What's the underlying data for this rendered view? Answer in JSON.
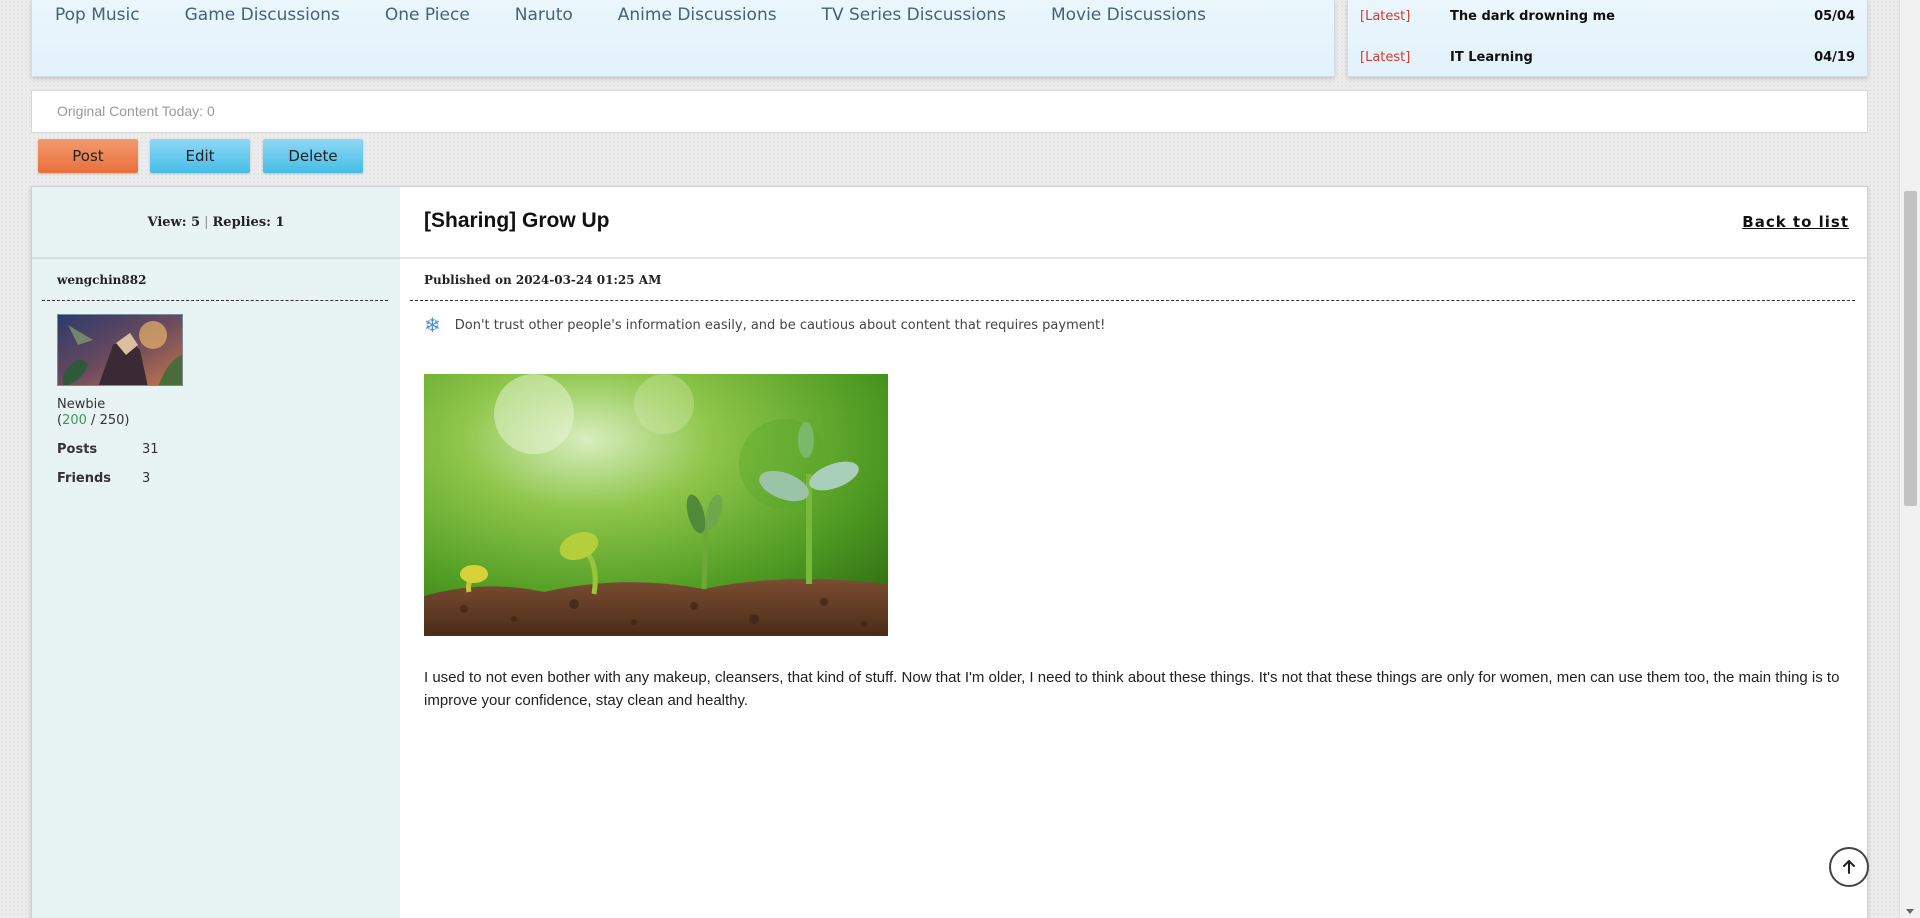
{
  "nav": {
    "items": [
      {
        "label": "Pop Music"
      },
      {
        "label": "Game Discussions"
      },
      {
        "label": "One Piece"
      },
      {
        "label": "Naruto"
      },
      {
        "label": "Anime Discussions"
      },
      {
        "label": "TV Series Discussions"
      },
      {
        "label": "Movie Discussions"
      }
    ]
  },
  "latest": {
    "items": [
      {
        "tag": "[Latest]",
        "title": "The dark drowning me",
        "date": "05/04"
      },
      {
        "tag": "[Latest]",
        "title": "IT Learning",
        "date": "04/19"
      }
    ]
  },
  "original_content": {
    "label": "Original Content Today: 0"
  },
  "actions": {
    "post": "Post",
    "edit": "Edit",
    "delete": "Delete"
  },
  "post": {
    "stats": {
      "views": "View: 5",
      "separator": "|",
      "replies": "Replies: 1"
    },
    "author": {
      "username": "wengchin882",
      "rank": "Newbie",
      "points_current": "200",
      "points_max": "250",
      "posts_label": "Posts",
      "posts_value": "31",
      "friends_label": "Friends",
      "friends_value": "3"
    },
    "title": "[Sharing] Grow Up",
    "back_label": "Back to list",
    "published": "Published on 2024-03-24 01:25 AM",
    "notice": "Don't trust other people's information easily, and be cautious about content that requires payment!",
    "body": "I used to not even bother with any makeup, cleansers, that kind of stuff. Now that I'm older, I need to think about these things. It's not that these things are only for women, men can use them too, the main thing is to improve your confidence, stay clean and healthy."
  },
  "colors": {
    "latest_tag": "#d43b2f",
    "nav_text": "#46627a",
    "post_button": "#e8703b",
    "edit_button": "#45bde6",
    "points_current": "#3a9a54"
  },
  "icons": {
    "notice": "snowflake-icon",
    "scroll_top": "arrow-up-icon"
  }
}
